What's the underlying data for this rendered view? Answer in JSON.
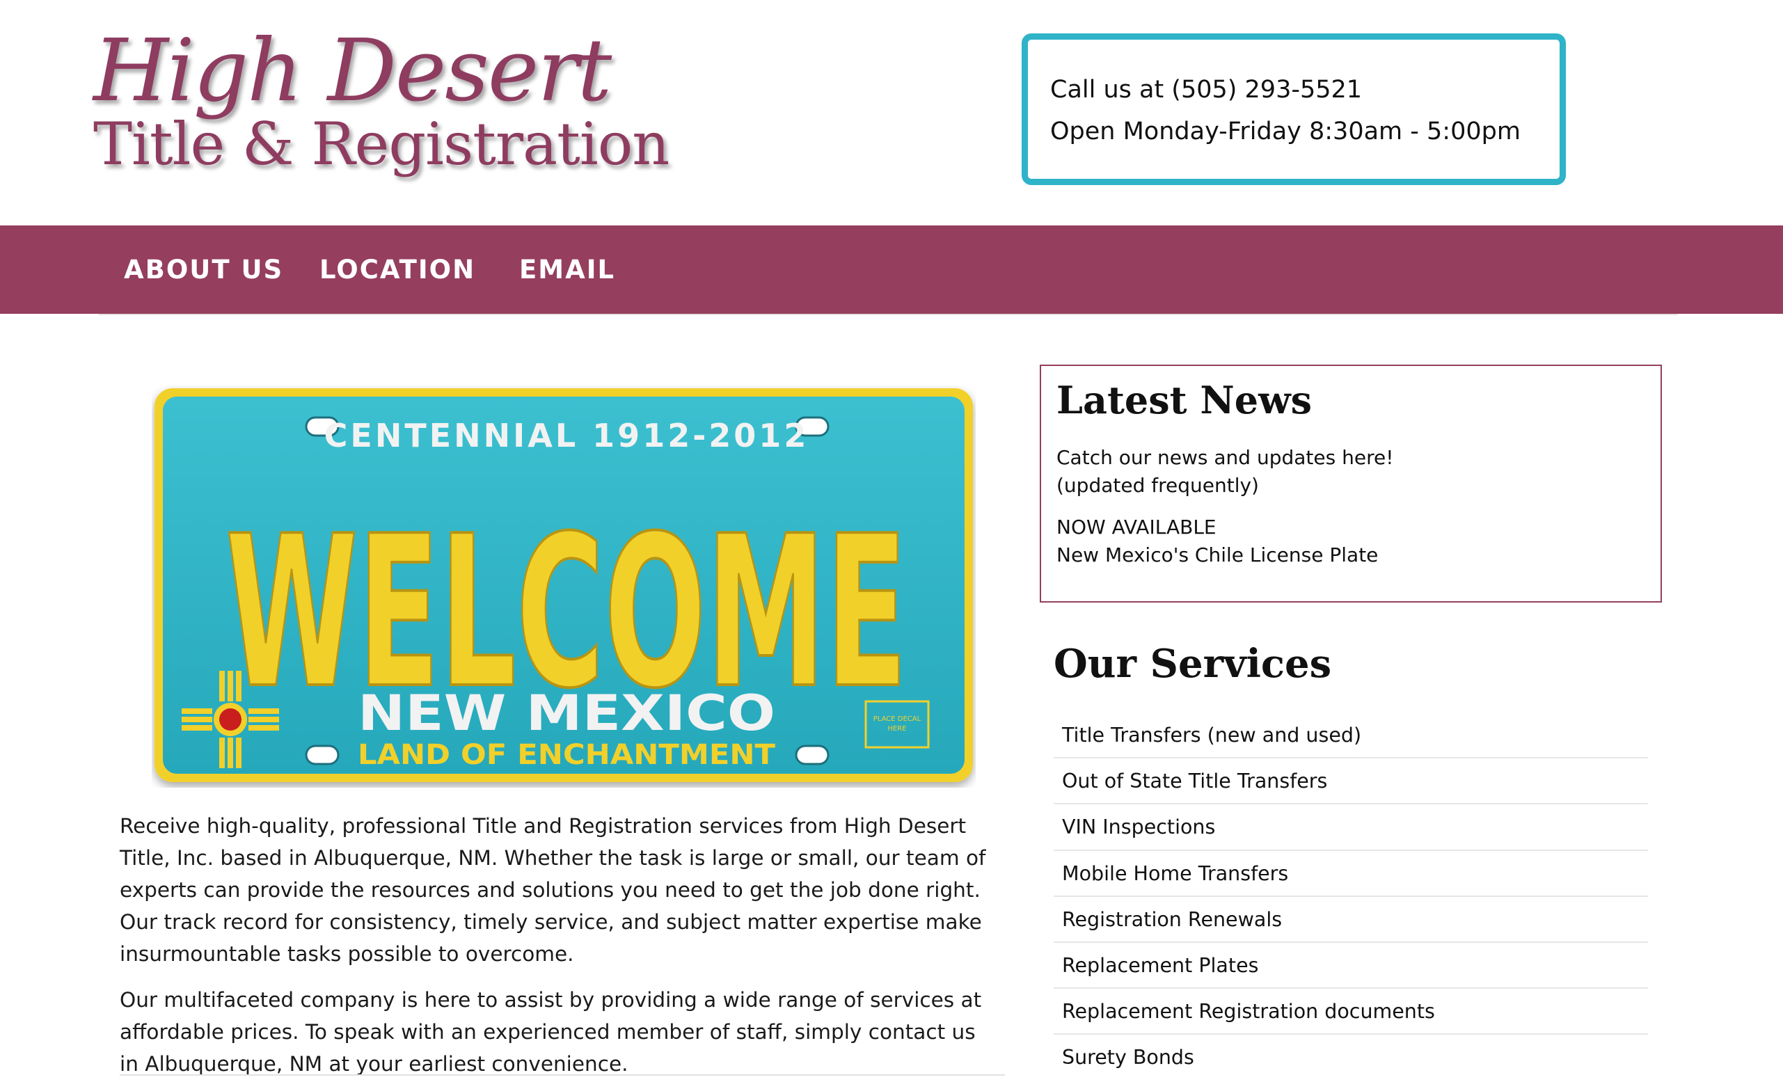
{
  "header": {
    "logo_line1": "High Desert",
    "logo_line2": "Title & Registration",
    "contact_phone": "Call us at (505) 293-5521",
    "contact_hours": "Open Monday-Friday 8:30am - 5:00pm"
  },
  "nav": {
    "items": [
      {
        "label": "ABOUT US"
      },
      {
        "label": "LOCATION"
      },
      {
        "label": "EMAIL"
      }
    ]
  },
  "hero_plate": {
    "top_text": "CENTENNIAL 1912-2012",
    "main_text": "WELCOME",
    "state_text": "NEW MEXICO",
    "slogan_text": "LAND OF ENCHANTMENT",
    "decal_text_line1": "PLACE DECAL",
    "decal_text_line2": "HERE",
    "colors": {
      "plate": "#2fb0c2",
      "yellow": "#f2d02a",
      "red": "#c81e1e",
      "white": "#f2f2f2"
    }
  },
  "main": {
    "paragraph1": "Receive high-quality, professional Title and Registration services from High Desert Title, Inc. based in Albuquerque, NM. Whether the task is large or small, our team of experts can provide the resources and solutions you need to get the job done right. Our track record for consistency, timely service, and subject matter expertise make insurmountable tasks possible to overcome.",
    "paragraph2": "Our multifaceted company is here to assist by providing a wide range of services at affordable prices. To speak with an experienced member of staff, simply contact us in Albuquerque, NM at your earliest convenience."
  },
  "news": {
    "title": "Latest News",
    "line1": "Catch our news and updates here!",
    "line2": "(updated frequently)",
    "line3": "NOW AVAILABLE",
    "line4": "New Mexico's Chile License Plate"
  },
  "services": {
    "title": "Our Services",
    "items": [
      {
        "label": "Title Transfers (new and used)"
      },
      {
        "label": "Out of State Title Transfers"
      },
      {
        "label": "VIN Inspections"
      },
      {
        "label": "Mobile Home Transfers"
      },
      {
        "label": "Registration Renewals"
      },
      {
        "label": "Replacement Plates"
      },
      {
        "label": "Replacement Registration documents"
      },
      {
        "label": "Surety Bonds"
      }
    ]
  },
  "theme": {
    "brand": "#953e5e",
    "accent": "#2fb3c8"
  }
}
